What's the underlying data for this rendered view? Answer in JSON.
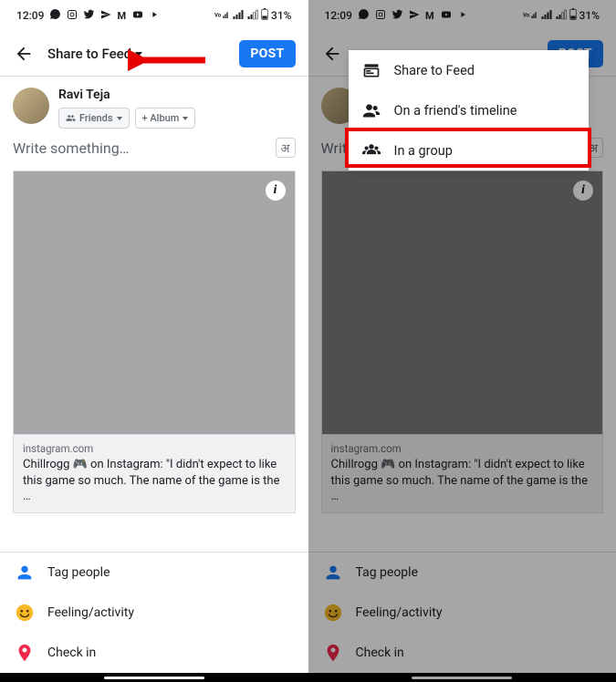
{
  "status": {
    "time": "12:09",
    "battery": "31%"
  },
  "header": {
    "share_label": "Share to Feed",
    "post_label": "POST"
  },
  "user": {
    "name": "Ravi Teja",
    "friends_chip": "Friends",
    "album_chip": "+ Album"
  },
  "compose": {
    "placeholder": "Write something…",
    "lang_glyph": "अ"
  },
  "preview": {
    "domain": "instagram.com",
    "title": "Chillrogg 🎮 on Instagram: \"I didn't expect to like this game so much. The name of the game is the …"
  },
  "actions": {
    "tag": "Tag people",
    "feeling": "Feeling/activity",
    "checkin": "Check in"
  },
  "dropdown": {
    "item1": "Share to Feed",
    "item2": "On a friend's timeline",
    "item3": "In a group"
  }
}
